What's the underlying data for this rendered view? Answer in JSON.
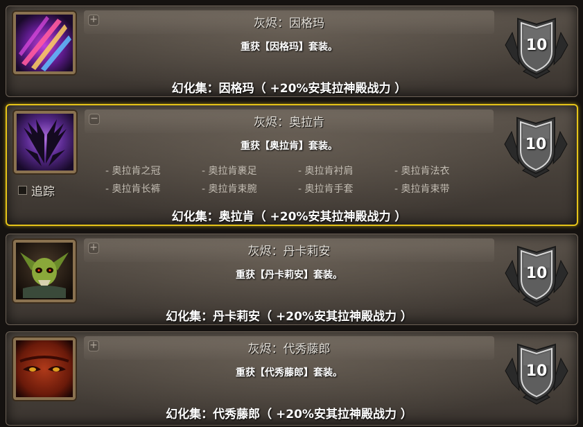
{
  "sets": [
    {
      "title": "灰烬：因格玛",
      "subtitle": "重获【因格玛】套装。",
      "footer": "幻化集：因格玛（ +20%安其拉神殿战力 ）",
      "badge": "10",
      "expand_symbol": "+",
      "selected": false,
      "icon": "purple-claw-slash-icon"
    },
    {
      "title": "灰烬：奥拉肯",
      "subtitle": "重获【奥拉肯】套装。",
      "footer": "幻化集：奥拉肯（ +20%安其拉神殿战力 ）",
      "badge": "10",
      "expand_symbol": "−",
      "selected": true,
      "icon": "dark-purple-wings-icon",
      "track_label": "追踪",
      "items": [
        "- 奥拉肯之冠",
        "- 奥拉肯裹足",
        "- 奥拉肯衬肩",
        "- 奥拉肯法衣",
        "- 奥拉肯长裤",
        "- 奥拉肯束腕",
        "- 奥拉肯手套",
        "- 奥拉肯束带"
      ]
    },
    {
      "title": "灰烬：丹卡莉安",
      "subtitle": "重获【丹卡莉安】套装。",
      "footer": "幻化集：丹卡莉安（ +20%安其拉神殿战力 ）",
      "badge": "10",
      "expand_symbol": "+",
      "selected": false,
      "icon": "green-skull-helm-icon"
    },
    {
      "title": "灰烬：代秀藤郎",
      "subtitle": "重获【代秀藤郎】套装。",
      "footer": "幻化集：代秀藤郎（ +20%安其拉神殿战力 ）",
      "badge": "10",
      "expand_symbol": "+",
      "selected": false,
      "icon": "red-demon-face-icon"
    }
  ],
  "colors": {
    "selected_border": "#e6c419",
    "panel_bg": "#4a433c",
    "text_white": "#ffffff",
    "item_text": "#c2bcb2"
  }
}
